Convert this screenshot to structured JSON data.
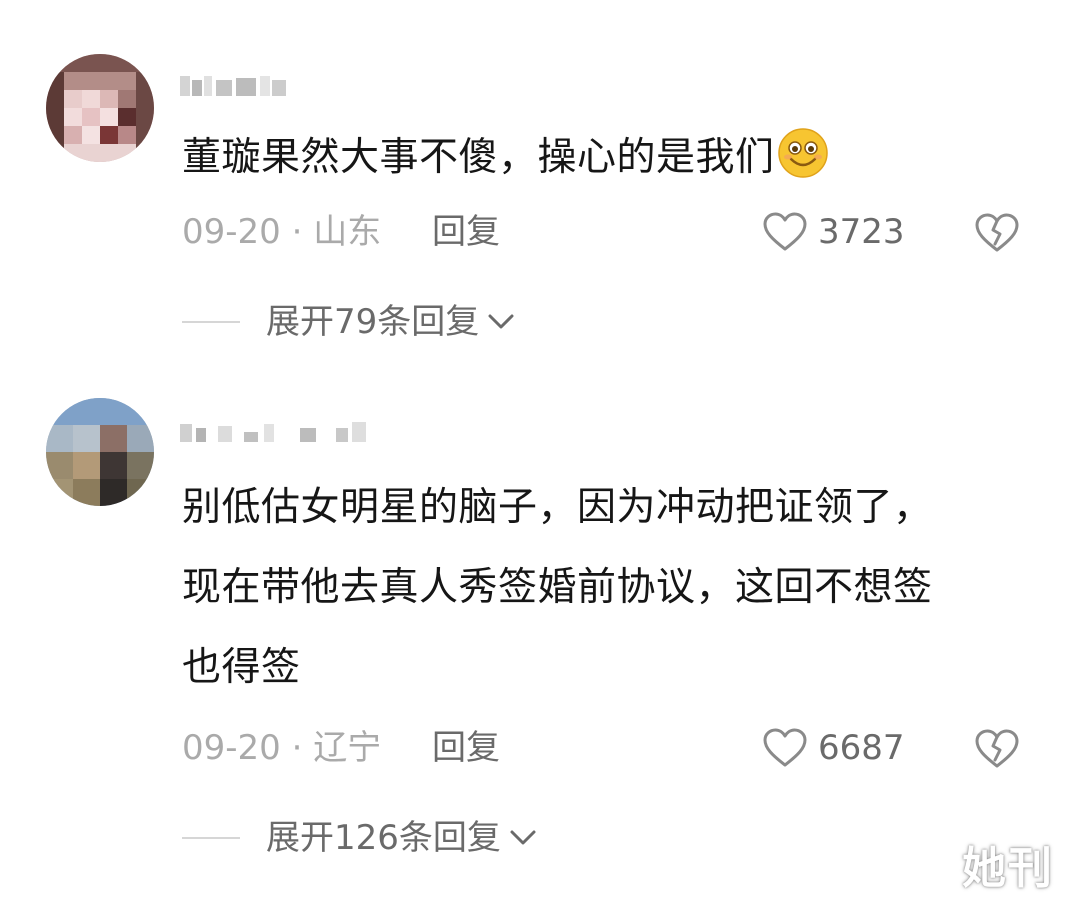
{
  "comments": [
    {
      "text": "董璇果然大事不傻，操心的是我们",
      "emoji": "smile-emoji",
      "date_location": "09-20 · 山东",
      "reply_label": "回复",
      "likes": "3723",
      "expand_label": "展开79条回复"
    },
    {
      "text_lines": [
        "别低估女明星的脑子，因为冲动把证领了，",
        "现在带他去真人秀签婚前协议，这回不想签",
        "也得签"
      ],
      "date_location": "09-20 · 辽宁",
      "reply_label": "回复",
      "likes": "6687",
      "expand_label": "展开126条回复"
    }
  ],
  "watermark": "她刊",
  "icons": [
    "heart-outline-icon",
    "broken-heart-icon",
    "chevron-down-icon"
  ],
  "colors": {
    "text": "#161616",
    "secondary": "#6a6a6a",
    "muted": "#aaaaaa",
    "divider": "#d6d6d6"
  }
}
